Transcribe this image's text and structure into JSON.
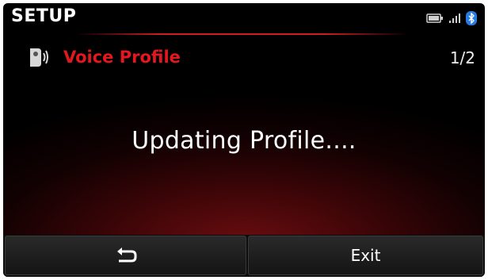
{
  "header": {
    "title": "SETUP",
    "icons": [
      "battery-icon",
      "signal-icon",
      "bluetooth-icon"
    ]
  },
  "subheader": {
    "icon": "voice-profile-icon",
    "title": "Voice Profile",
    "page": "1/2"
  },
  "main": {
    "message": "Updating Profile...."
  },
  "buttons": {
    "back_icon": "back-arrow-icon",
    "exit_label": "Exit"
  },
  "colors": {
    "accent": "#e3171f",
    "background": "#000000",
    "bluetooth": "#2a7be0"
  }
}
